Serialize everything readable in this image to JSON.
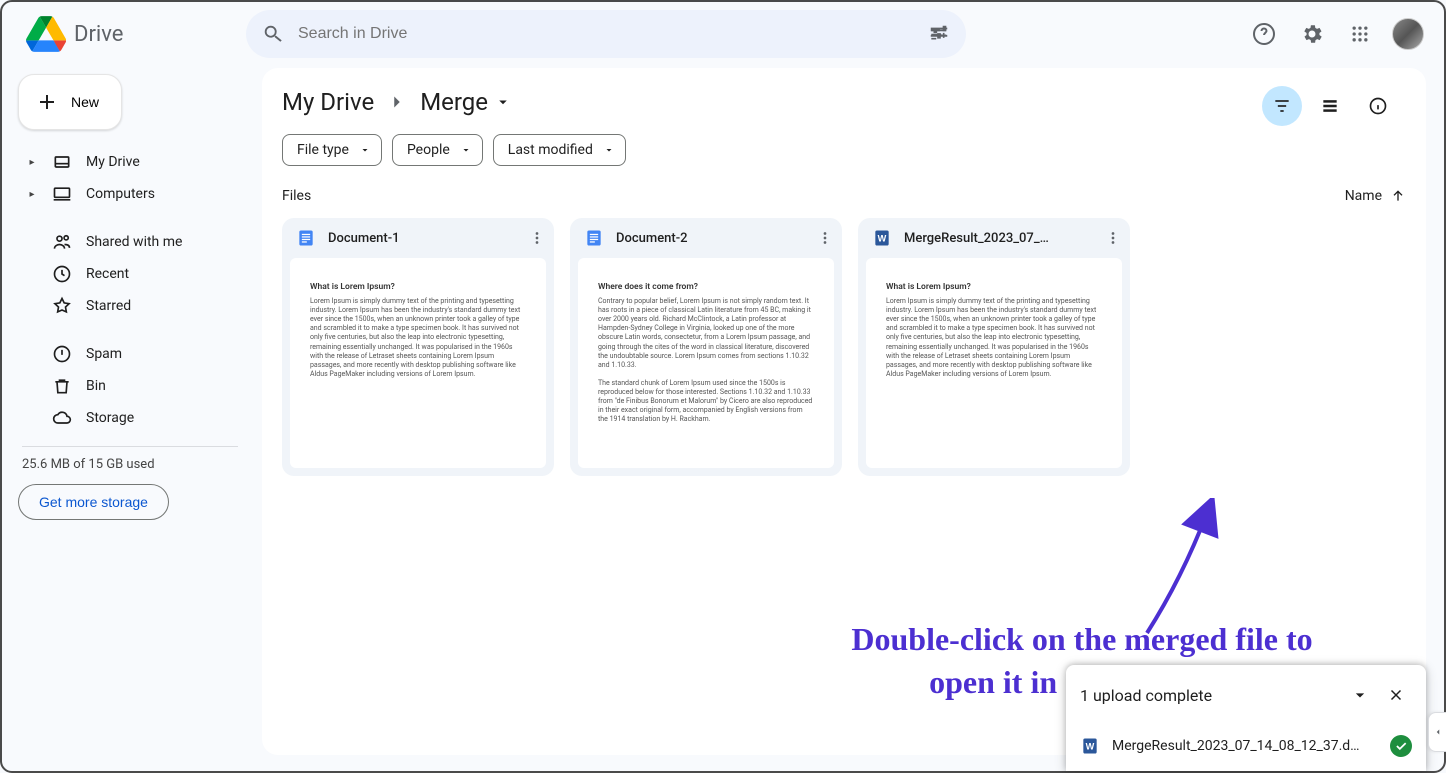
{
  "app": {
    "name": "Drive"
  },
  "search": {
    "placeholder": "Search in Drive"
  },
  "sidebar": {
    "new_label": "New",
    "items": [
      {
        "label": "My Drive",
        "caret": true
      },
      {
        "label": "Computers",
        "caret": true
      },
      {
        "label": "Shared with me",
        "caret": false
      },
      {
        "label": "Recent",
        "caret": false
      },
      {
        "label": "Starred",
        "caret": false
      },
      {
        "label": "Spam",
        "caret": false
      },
      {
        "label": "Bin",
        "caret": false
      },
      {
        "label": "Storage",
        "caret": false
      }
    ],
    "storage_text": "25.6 MB of 15 GB used",
    "storage_button": "Get more storage"
  },
  "breadcrumb": {
    "root": "My Drive",
    "current": "Merge"
  },
  "filters": {
    "file_type": "File type",
    "people": "People",
    "last_modified": "Last modified"
  },
  "section": {
    "label": "Files",
    "sort": "Name"
  },
  "files": [
    {
      "name": "Document-1",
      "type": "gdoc",
      "thumb_title": "What is Lorem Ipsum?"
    },
    {
      "name": "Document-2",
      "type": "gdoc",
      "thumb_title": "Where does it come from?"
    },
    {
      "name": "MergeResult_2023_07_…",
      "type": "word",
      "thumb_title": "What is Lorem Ipsum?"
    }
  ],
  "annotation": "Double-click on the merged file to open it in Google Docs",
  "toast": {
    "title": "1 upload complete",
    "file": "MergeResult_2023_07_14_08_12_37.d…"
  }
}
